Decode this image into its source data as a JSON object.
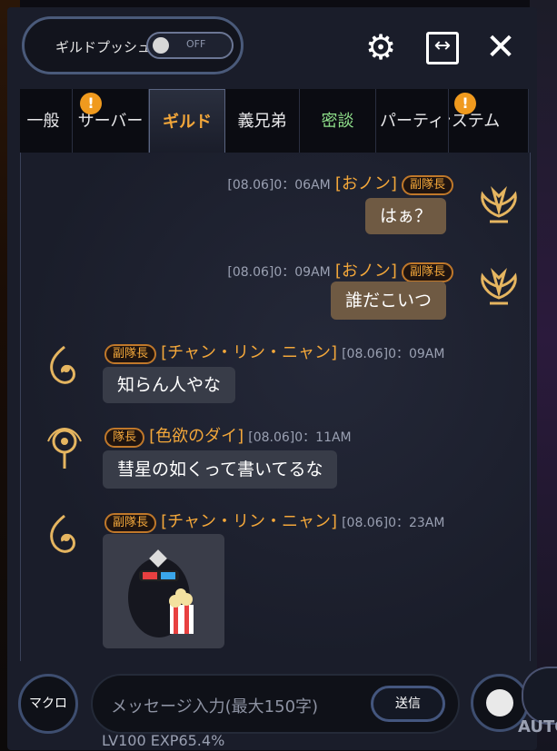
{
  "top_bar": {
    "guild_push_label": "ギルドプッシュ",
    "toggle_state": "OFF"
  },
  "tabs": [
    {
      "label": "一般",
      "badge": ""
    },
    {
      "label": "サーバー",
      "badge": "!"
    },
    {
      "label": "ギルド",
      "badge": ""
    },
    {
      "label": "義兄弟",
      "badge": ""
    },
    {
      "label": "密談",
      "badge": ""
    },
    {
      "label": "パーティ",
      "badge": ""
    },
    {
      "label": "システム",
      "badge": "!"
    }
  ],
  "messages": [
    {
      "side": "right",
      "time": "[08.06]0：06AM",
      "name": "[おノン]",
      "rank": "副隊長",
      "text": "はぁ？"
    },
    {
      "side": "right",
      "time": "[08.06]0：09AM",
      "name": "[おノン]",
      "rank": "副隊長",
      "text": "誰だこいつ"
    },
    {
      "side": "left",
      "time": "[08.06]0：09AM",
      "name": "[チャン・リン・ニャン]",
      "rank": "副隊長",
      "text": "知らん人やな"
    },
    {
      "side": "left",
      "time": "[08.06]0：11AM",
      "name": "[色欲のダイ]",
      "rank": "隊長",
      "text": "彗星の如くって書いてるな"
    },
    {
      "side": "left",
      "time": "[08.06]0：23AM",
      "name": "[チャン・リン・ニャン]",
      "rank": "副隊長",
      "text": ""
    }
  ],
  "bottom_bar": {
    "macro_label": "マクロ",
    "input_placeholder": "メッセージ入力(最大150字)",
    "send_label": "送信",
    "auto_label": "AUTO",
    "level_text": "LV100  EXP65.4%"
  },
  "icons": {
    "settings": "gear-icon",
    "expand": "expand-horizontal-icon",
    "close": "close-icon",
    "emoji": "emoji-face-icon"
  },
  "colors": {
    "accent": "#f3a73a",
    "badge": "#f09a1e",
    "bubble_mine": "#6f5a43",
    "bubble_theirs": "#383c48"
  }
}
